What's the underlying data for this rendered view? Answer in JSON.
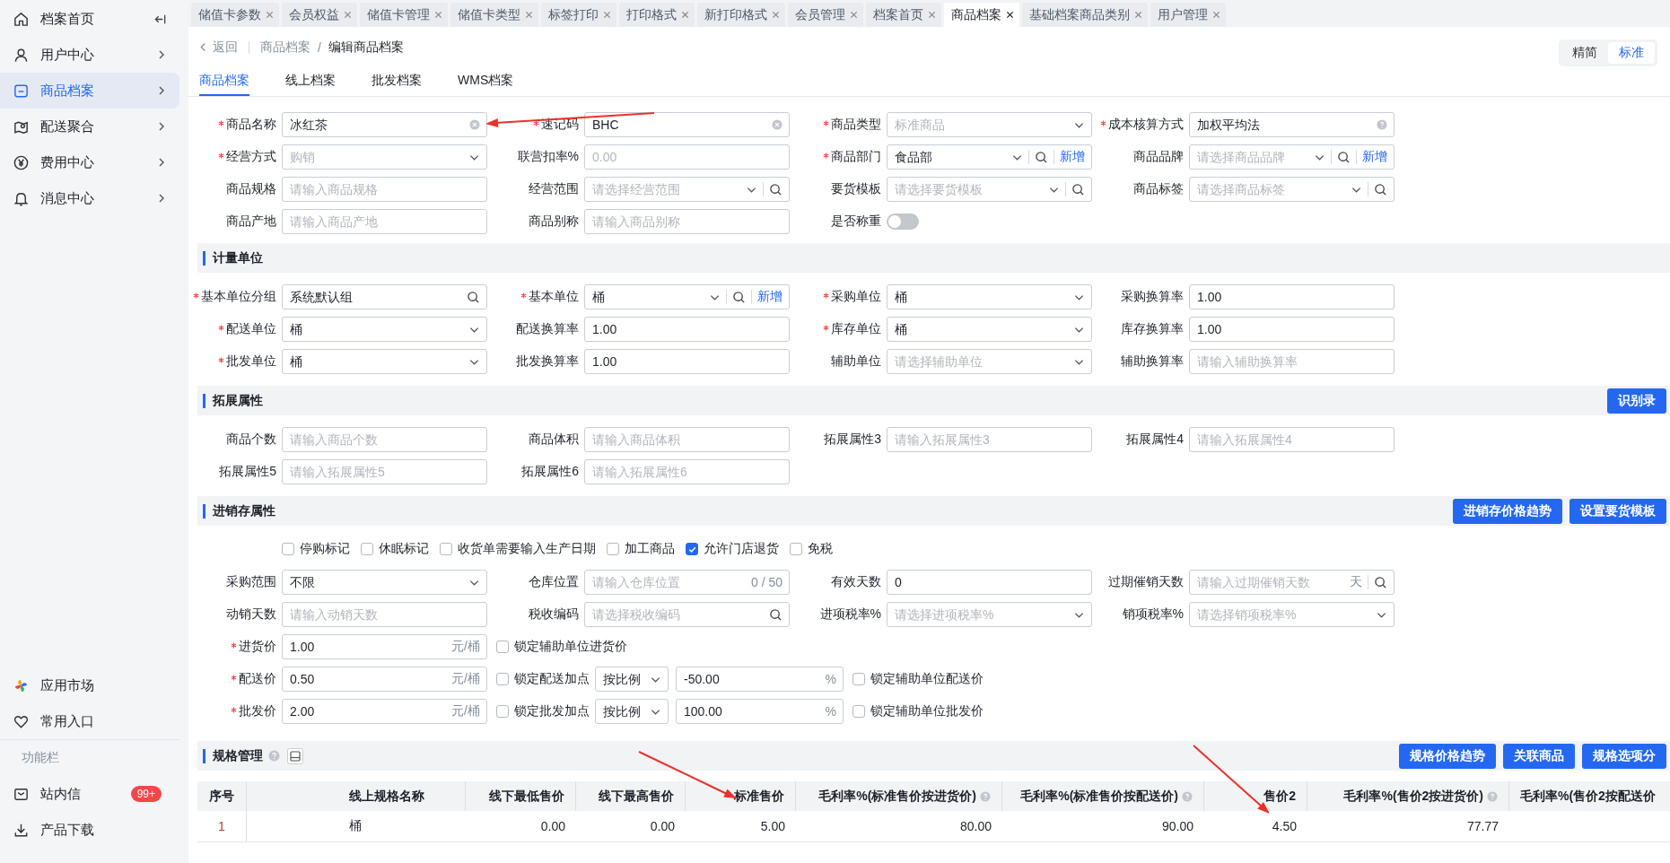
{
  "sidebar": {
    "items": [
      {
        "label": "档案首页",
        "selected": false
      },
      {
        "label": "用户中心",
        "selected": false,
        "expanded": false
      },
      {
        "label": "商品档案",
        "selected": true,
        "expanded": false
      },
      {
        "label": "配送聚合",
        "selected": false,
        "expanded": false
      },
      {
        "label": "费用中心",
        "selected": false,
        "expanded": false
      },
      {
        "label": "消息中心",
        "selected": false,
        "expanded": false
      }
    ],
    "shortcuts": [
      {
        "label": "应用市场"
      },
      {
        "label": "常用入口"
      }
    ],
    "tools_title": "功能栏",
    "tools": [
      {
        "label": "站内信",
        "badge": "99+"
      },
      {
        "label": "产品下载"
      }
    ]
  },
  "tabs": [
    {
      "label": "储值卡参数",
      "selected": false
    },
    {
      "label": "会员权益",
      "selected": false
    },
    {
      "label": "储值卡管理",
      "selected": false
    },
    {
      "label": "储值卡类型",
      "selected": false
    },
    {
      "label": "标签打印",
      "selected": false
    },
    {
      "label": "打印格式",
      "selected": false
    },
    {
      "label": "新打印格式",
      "selected": false
    },
    {
      "label": "会员管理",
      "selected": false
    },
    {
      "label": "档案首页",
      "selected": false
    },
    {
      "label": "商品档案",
      "selected": true
    },
    {
      "label": "基础档案商品类别",
      "selected": false
    },
    {
      "label": "用户管理",
      "selected": false
    }
  ],
  "header": {
    "back": "返回",
    "separator": "/",
    "breadcrumb": [
      "商品档案",
      "编辑商品档案"
    ],
    "view_modes": [
      {
        "label": "精简",
        "selected": false
      },
      {
        "label": "标准",
        "selected": true
      }
    ]
  },
  "subtabs": [
    {
      "label": "商品档案",
      "selected": true
    },
    {
      "label": "线上档案",
      "selected": false
    },
    {
      "label": "批发档案",
      "selected": false
    },
    {
      "label": "WMS档案",
      "selected": false
    }
  ],
  "sections": [
    {
      "fields": [
        {
          "label": "商品名称",
          "required": true,
          "kind": "input",
          "value": "冰红茶",
          "clear": true
        },
        {
          "label": "速记码",
          "required": true,
          "kind": "input",
          "value": "BHC",
          "clear": true
        },
        {
          "label": "商品类型",
          "required": true,
          "kind": "select",
          "placeholder": "标准商品"
        },
        {
          "label": "成本核算方式",
          "required": true,
          "kind": "input",
          "value": "加权平均法",
          "help": true
        },
        {
          "label": "经营方式",
          "required": true,
          "kind": "select",
          "placeholder": "购销"
        },
        {
          "label": "联营扣率%",
          "required": false,
          "kind": "input",
          "placeholder": "0.00"
        },
        {
          "label": "商品部门",
          "required": true,
          "kind": "select",
          "value": "食品部",
          "search": true,
          "add": "新增"
        },
        {
          "label": "商品品牌",
          "required": false,
          "kind": "select",
          "placeholder": "请选择商品品牌",
          "search": true,
          "add": "新增"
        },
        {
          "label": "商品规格",
          "required": false,
          "kind": "input",
          "placeholder": "请输入商品规格"
        },
        {
          "label": "经营范围",
          "required": false,
          "kind": "select",
          "placeholder": "请选择经营范围",
          "search": true
        },
        {
          "label": "要货模板",
          "required": false,
          "kind": "select",
          "placeholder": "请选择要货模板",
          "search": true
        },
        {
          "label": "商品标签",
          "required": false,
          "kind": "select",
          "placeholder": "请选择商品标签",
          "search": true
        },
        {
          "label": "商品产地",
          "required": false,
          "kind": "input",
          "placeholder": "请输入商品产地"
        },
        {
          "label": "商品别称",
          "required": false,
          "kind": "input",
          "placeholder": "请输入商品别称"
        },
        {
          "label": "是否称重",
          "required": false,
          "kind": "toggle",
          "on": false
        }
      ]
    },
    {
      "title": "计量单位",
      "fields": [
        {
          "label": "基本单位分组",
          "required": true,
          "kind": "input",
          "value": "系统默认组",
          "search": true
        },
        {
          "label": "基本单位",
          "required": true,
          "kind": "select",
          "value": "桶",
          "search": true,
          "add": "新增"
        },
        {
          "label": "采购单位",
          "required": true,
          "kind": "select",
          "value": "桶"
        },
        {
          "label": "采购换算率",
          "required": false,
          "kind": "input",
          "value": "1.00"
        },
        {
          "label": "配送单位",
          "required": true,
          "kind": "select",
          "value": "桶"
        },
        {
          "label": "配送换算率",
          "required": false,
          "kind": "input",
          "value": "1.00"
        },
        {
          "label": "库存单位",
          "required": true,
          "kind": "select",
          "value": "桶"
        },
        {
          "label": "库存换算率",
          "required": false,
          "kind": "input",
          "value": "1.00"
        },
        {
          "label": "批发单位",
          "required": true,
          "kind": "select",
          "value": "桶"
        },
        {
          "label": "批发换算率",
          "required": false,
          "kind": "input",
          "value": "1.00"
        },
        {
          "label": "辅助单位",
          "required": false,
          "kind": "select",
          "placeholder": "请选择辅助单位"
        },
        {
          "label": "辅助换算率",
          "required": false,
          "kind": "input",
          "placeholder": "请输入辅助换算率"
        }
      ]
    },
    {
      "title": "拓展属性",
      "buttons": [
        "识别录"
      ],
      "fields": [
        {
          "label": "商品个数",
          "required": false,
          "kind": "input",
          "placeholder": "请输入商品个数"
        },
        {
          "label": "商品体积",
          "required": false,
          "kind": "input",
          "placeholder": "请输入商品体积"
        },
        {
          "label": "拓展属性3",
          "required": false,
          "kind": "input",
          "placeholder": "请输入拓展属性3"
        },
        {
          "label": "拓展属性4",
          "required": false,
          "kind": "input",
          "placeholder": "请输入拓展属性4"
        },
        {
          "label": "拓展属性5",
          "required": false,
          "kind": "input",
          "placeholder": "请输入拓展属性5"
        },
        {
          "label": "拓展属性6",
          "required": false,
          "kind": "input",
          "placeholder": "请输入拓展属性6"
        }
      ]
    },
    {
      "title": "进销存属性",
      "buttons": [
        "进销存价格趋势",
        "设置要货模板"
      ],
      "checkboxes": [
        {
          "label": "停购标记",
          "checked": false
        },
        {
          "label": "休眠标记",
          "checked": false
        },
        {
          "label": "收货单需要输入生产日期",
          "checked": false
        },
        {
          "label": "加工商品",
          "checked": false
        },
        {
          "label": "允许门店退货",
          "checked": true
        },
        {
          "label": "免税",
          "checked": false
        }
      ],
      "fields": [
        {
          "label": "采购范围",
          "required": false,
          "kind": "select",
          "value": "不限"
        },
        {
          "label": "仓库位置",
          "required": false,
          "kind": "input",
          "placeholder": "请输入仓库位置",
          "counter": "0 / 50"
        },
        {
          "label": "有效天数",
          "required": false,
          "kind": "input",
          "value": "0"
        },
        {
          "label": "过期催销天数",
          "required": false,
          "kind": "input",
          "placeholder": "请输入过期催销天数",
          "suffix": "天",
          "search": true
        },
        {
          "label": "动销天数",
          "required": false,
          "kind": "input",
          "placeholder": "请输入动销天数"
        },
        {
          "label": "税收编码",
          "required": false,
          "kind": "input",
          "placeholder": "请选择税收编码",
          "search": true
        },
        {
          "label": "进项税率%",
          "required": false,
          "kind": "select",
          "placeholder": "请选择进项税率%"
        },
        {
          "label": "销项税率%",
          "required": false,
          "kind": "select",
          "placeholder": "请选择销项税率%"
        }
      ],
      "price_rows": [
        {
          "label": "进货价",
          "required": true,
          "value": "1.00",
          "suffix": "元/桶",
          "parts": [
            {
              "kind": "check",
              "label": "锁定辅助单位进货价",
              "checked": false
            }
          ]
        },
        {
          "label": "配送价",
          "required": true,
          "value": "0.50",
          "suffix": "元/桶",
          "parts": [
            {
              "kind": "check",
              "label": "锁定配送加点",
              "checked": false
            },
            {
              "kind": "select",
              "value": "按比例"
            },
            {
              "kind": "input",
              "value": "-50.00",
              "suffix": "%"
            },
            {
              "kind": "check",
              "label": "锁定辅助单位配送价",
              "checked": false
            }
          ]
        },
        {
          "label": "批发价",
          "required": true,
          "value": "2.00",
          "suffix": "元/桶",
          "parts": [
            {
              "kind": "check",
              "label": "锁定批发加点",
              "checked": false
            },
            {
              "kind": "select",
              "value": "按比例"
            },
            {
              "kind": "input",
              "value": "100.00",
              "suffix": "%"
            },
            {
              "kind": "check",
              "label": "锁定辅助单位批发价",
              "checked": false
            }
          ]
        }
      ]
    },
    {
      "title": "规格管理",
      "help": true,
      "buttons": [
        "规格价格趋势",
        "关联商品",
        "规格选项分"
      ],
      "table": {
        "columns": [
          {
            "label": "序号",
            "help": false
          },
          {
            "label": "线上规格名称",
            "help": false
          },
          {
            "label": "线下最低售价",
            "help": false
          },
          {
            "label": "线下最高售价",
            "help": false
          },
          {
            "label": "标准售价",
            "help": false
          },
          {
            "label": "毛利率%(标准售价按进货价)",
            "help": true
          },
          {
            "label": "毛利率%(标准售价按配送价)",
            "help": true
          },
          {
            "label": "售价2",
            "help": false
          },
          {
            "label": "毛利率%(售价2按进货价)",
            "help": true
          },
          {
            "label": "毛利率%(售价2按配送价",
            "help": false
          }
        ],
        "rows": [
          {
            "cells": [
              "1",
              "桶",
              "0.00",
              "0.00",
              "5.00",
              "80.00",
              "90.00",
              "4.50",
              "77.77"
            ]
          }
        ]
      }
    }
  ]
}
